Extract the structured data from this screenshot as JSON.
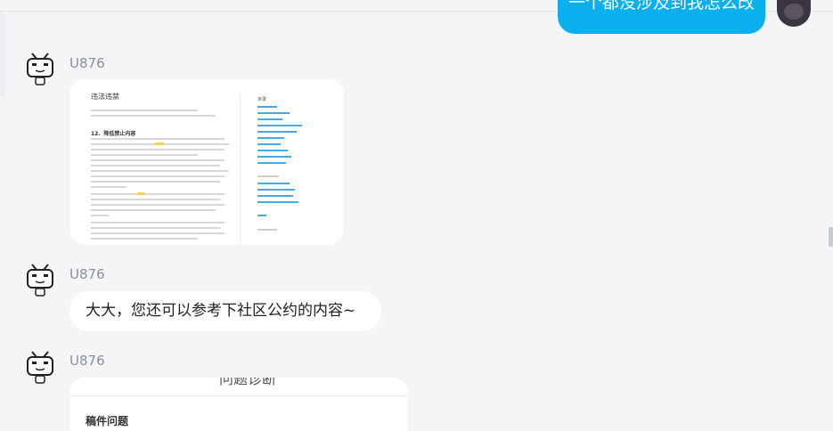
{
  "self_message": {
    "text": "一个都没涉及到我怎么改"
  },
  "messages": [
    {
      "user": "U876",
      "type": "image",
      "doc_title": "违法违禁",
      "doc_section": "12、降低禁止内容",
      "toc_title": "目录"
    },
    {
      "user": "U876",
      "type": "text",
      "text": "大大，您还可以参考下社区公约的内容~"
    },
    {
      "user": "U876",
      "type": "image",
      "header": "问题诊断",
      "subheading": "稿件问题"
    }
  ],
  "colors": {
    "self_bubble": "#0ab0ee",
    "background": "#f4f5f7",
    "link": "#4aa7e6"
  }
}
